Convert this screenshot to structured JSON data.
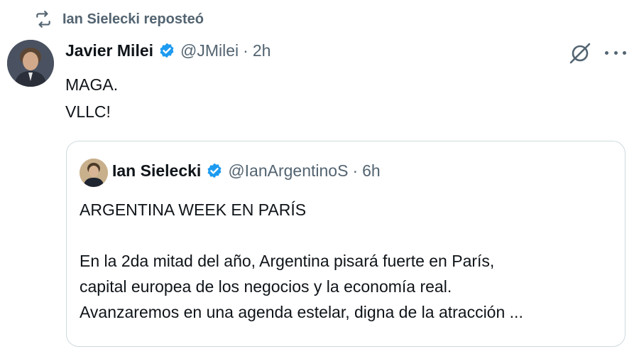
{
  "repost": {
    "label": "Ian Sielecki reposteó",
    "icon": "repost-icon"
  },
  "tweet": {
    "author_name": "Javier Milei",
    "handle": "@JMilei",
    "separator": "·",
    "time": "2h",
    "lines": [
      "MAGA.",
      "VLLC!"
    ],
    "icons": [
      "verified-badge-icon",
      "grok-icon",
      "more-icon"
    ]
  },
  "quote": {
    "author_name": "Ian Sielecki",
    "handle": "@IanArgentinoS",
    "separator": "·",
    "time": "6h",
    "title": "ARGENTINA WEEK EN PARÍS",
    "body_lines": [
      "En la 2da mitad del año, Argentina pisará fuerte en París,",
      "capital europea de los negocios y la economía real.",
      "Avanzaremos en una agenda estelar, digna de la atracción ..."
    ]
  },
  "colors": {
    "text": "#0f1419",
    "secondary": "#536471",
    "verified": "#1d9bf0",
    "border": "#cfd9de"
  }
}
